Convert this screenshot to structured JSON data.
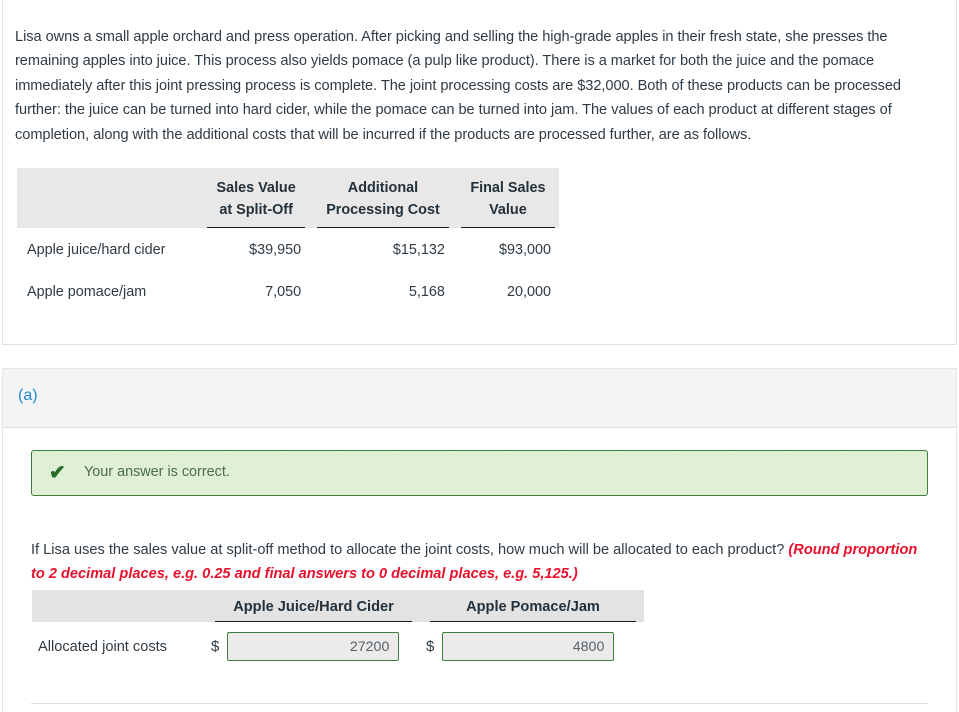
{
  "problem": {
    "statement": "Lisa owns a small apple orchard and press operation. After picking and selling the high-grade apples in their fresh state, she presses the remaining apples into juice. This process also yields pomace (a pulp like product). There is a market for both the juice and the pomace immediately after this joint pressing process is complete. The joint processing costs are $32,000. Both of these products can be processed further: the juice can be turned into hard cider, while the pomace can be turned into jam. The values of each product at different stages of completion, along with the additional costs that will be incurred if the products are processed further, are as follows."
  },
  "data_table": {
    "headers": {
      "blank": "",
      "col1_line1": "Sales Value",
      "col1_line2": "at Split-Off",
      "col2_line1": "Additional",
      "col2_line2": "Processing Cost",
      "col3_line1": "Final Sales",
      "col3_line2": "Value"
    },
    "rows": [
      {
        "label": "Apple juice/hard cider",
        "sales_value_at_split_off": "$39,950",
        "additional_processing_cost": "$15,132",
        "final_sales_value": "$93,000"
      },
      {
        "label": "Apple pomace/jam",
        "sales_value_at_split_off": "7,050",
        "additional_processing_cost": "5,168",
        "final_sales_value": "20,000"
      }
    ]
  },
  "part": {
    "label": "(a)"
  },
  "banner": {
    "icon": "check-icon",
    "text": "Your answer is correct.",
    "background_color": "#dff0d6",
    "border_color": "#3c7d3c"
  },
  "prompt": {
    "question": "If Lisa uses the sales value at split-off method to allocate the joint costs, how much will be allocated to each product? ",
    "hint": "(Round proportion to 2 decimal places, e.g. 0.25 and final answers to 0 decimal places, e.g. 5,125.)",
    "hint_color": "#e8112d"
  },
  "answer_table": {
    "headers": {
      "blank": "",
      "col1": "Apple Juice/Hard Cider",
      "col2": "Apple Pomace/Jam"
    },
    "row_label": "Allocated joint costs",
    "currency_symbol": "$",
    "apple_juice_value": "27200",
    "apple_pomace_value": "4800",
    "input_border_color": "#3c7d3c"
  }
}
